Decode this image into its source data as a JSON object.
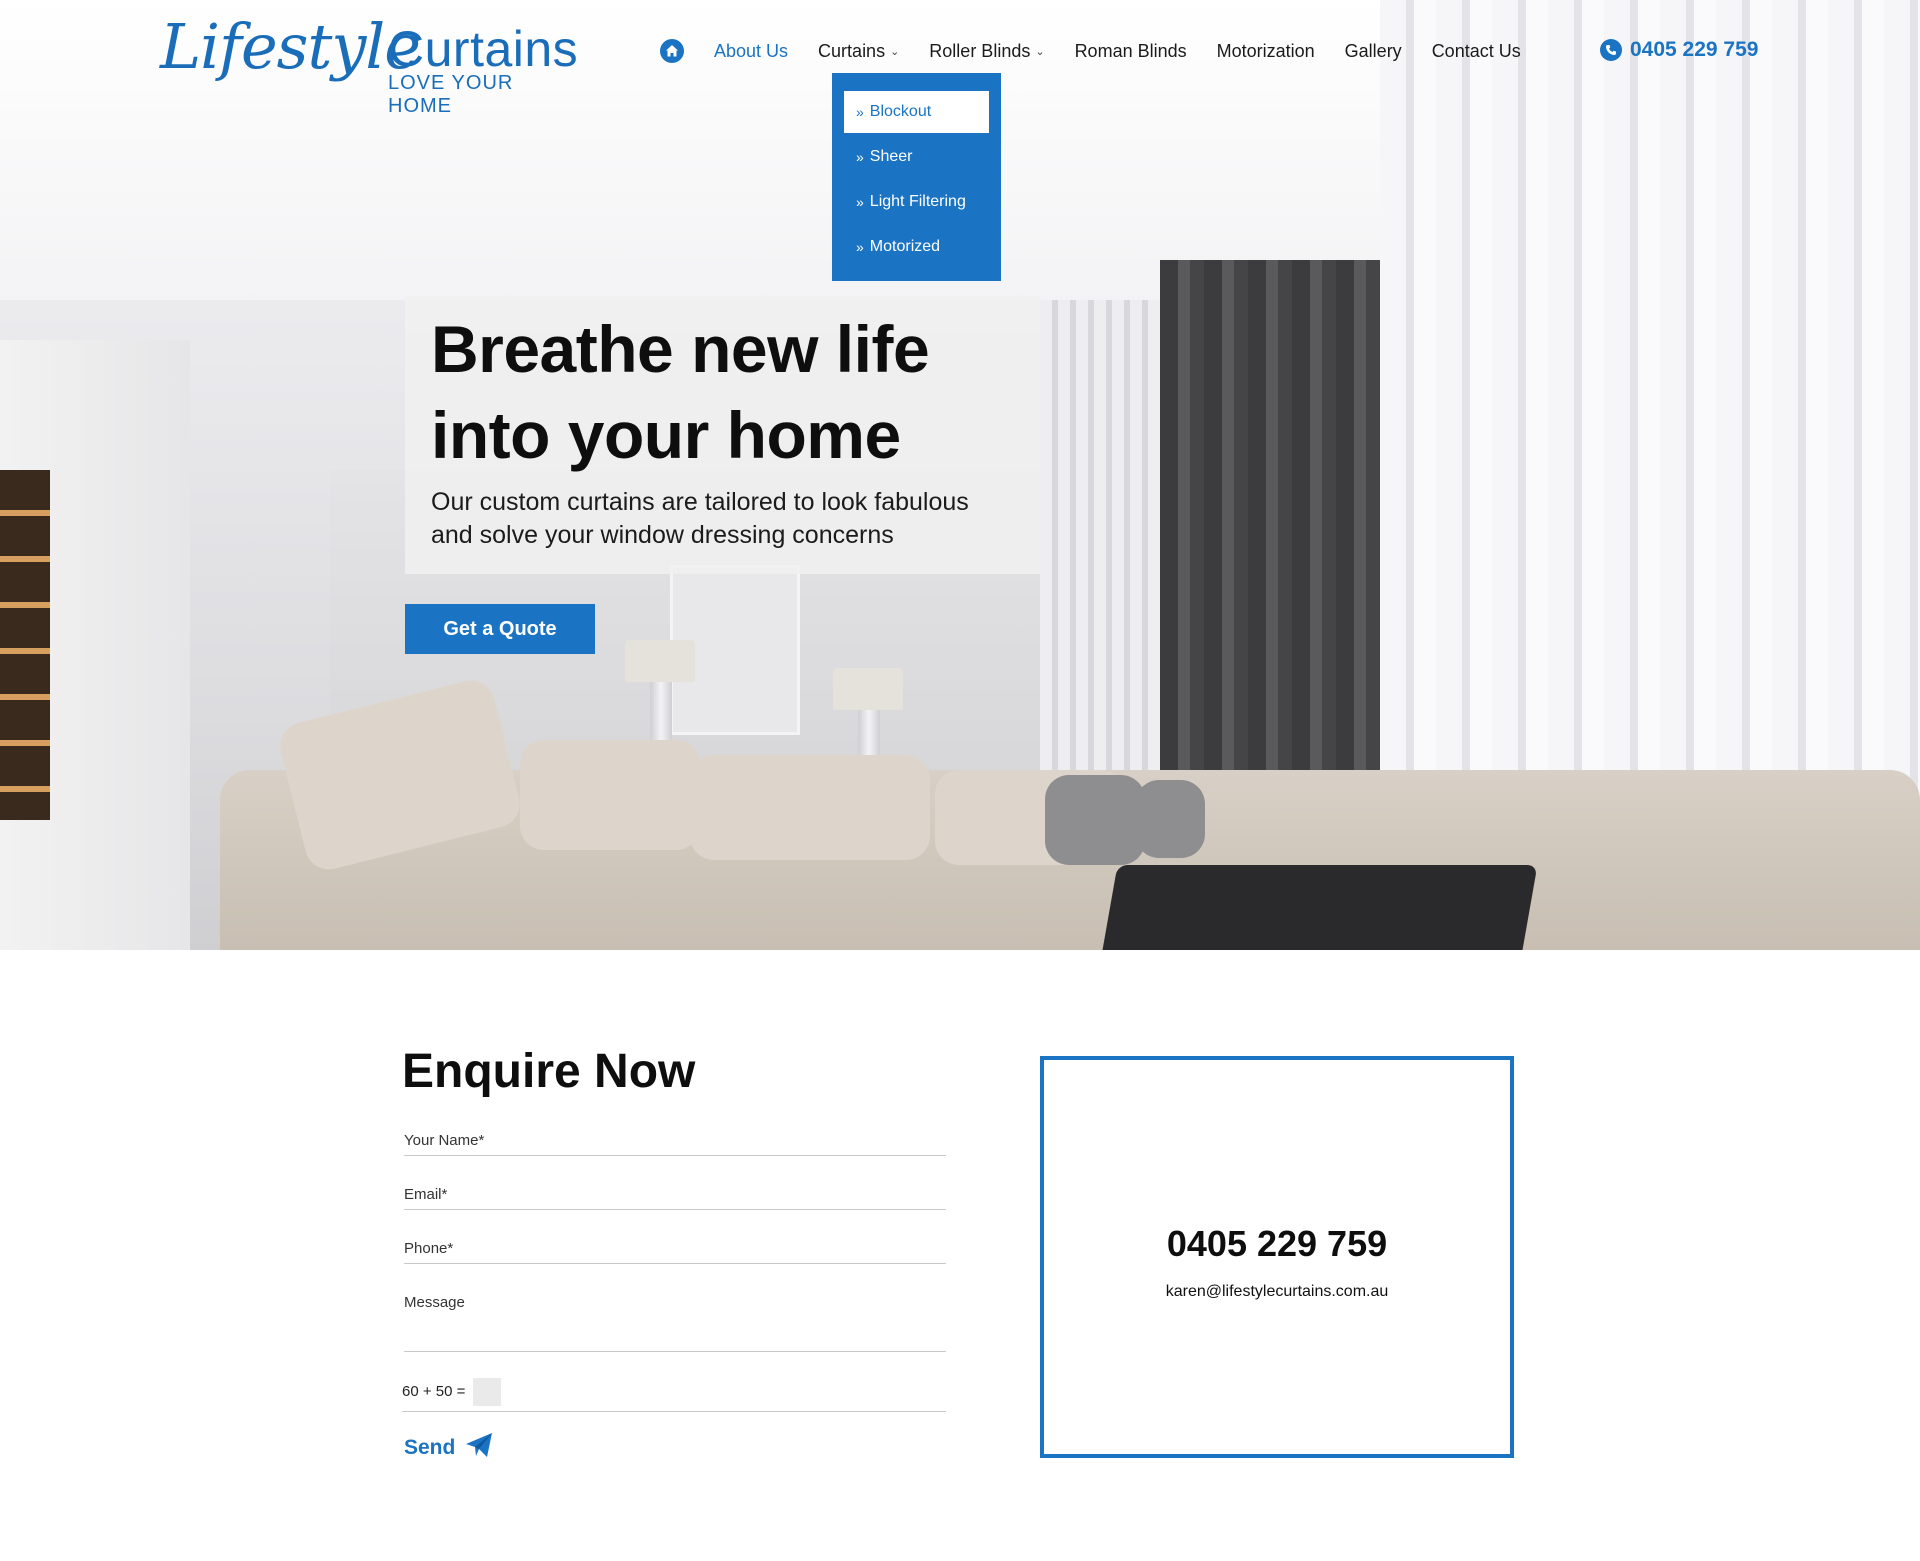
{
  "header": {
    "logo": {
      "script": "Lifestyle",
      "brand": "Curtains",
      "tagline": "LOVE YOUR HOME"
    },
    "nav": [
      {
        "label": "About Us",
        "active": true,
        "has_dropdown": false
      },
      {
        "label": "Curtains",
        "active": false,
        "has_dropdown": true
      },
      {
        "label": "Roller Blinds",
        "active": false,
        "has_dropdown": true
      },
      {
        "label": "Roman Blinds",
        "active": false,
        "has_dropdown": false
      },
      {
        "label": "Motorization",
        "active": false,
        "has_dropdown": false
      },
      {
        "label": "Gallery",
        "active": false,
        "has_dropdown": false
      },
      {
        "label": "Contact Us",
        "active": false,
        "has_dropdown": false
      }
    ],
    "phone": "0405 229 759",
    "dropdown": [
      {
        "label": "Blockout",
        "selected": true
      },
      {
        "label": "Sheer",
        "selected": false
      },
      {
        "label": "Light Filtering",
        "selected": false
      },
      {
        "label": "Motorized",
        "selected": false
      }
    ]
  },
  "hero": {
    "title_line1": "Breathe new life",
    "title_line2": "into your home",
    "subtitle_line1": "Our custom curtains are tailored to look fabulous",
    "subtitle_line2": "and solve your window dressing concerns",
    "cta": "Get a Quote"
  },
  "enquire": {
    "title": "Enquire Now",
    "fields": {
      "name": "Your Name*",
      "email": "Email*",
      "phone": "Phone*",
      "message": "Message"
    },
    "captcha": "60 + 50 =",
    "send": "Send"
  },
  "contact": {
    "phone": "0405 229 759",
    "email": "karen@lifestylecurtains.com.au"
  },
  "colors": {
    "accent": "#1a73c3",
    "text": "#0e0e0e"
  },
  "icons": [
    "home-icon",
    "chevron-down-icon",
    "phone-icon",
    "double-chevron-right-icon",
    "paper-plane-icon"
  ]
}
